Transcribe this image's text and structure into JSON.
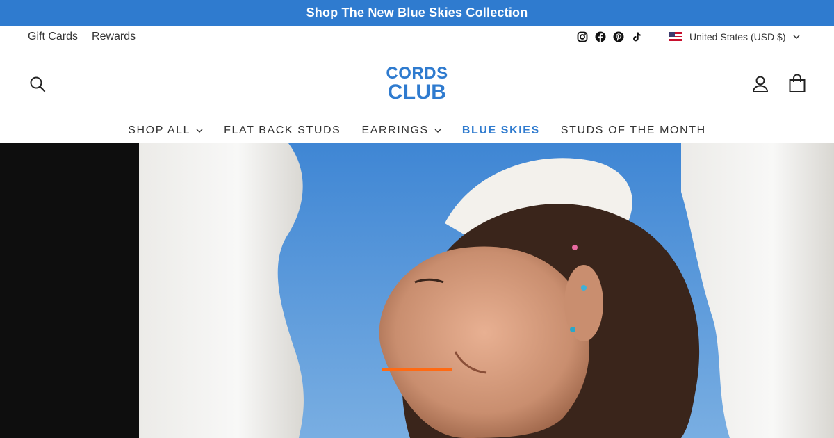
{
  "announcement": {
    "text": "Shop The New Blue Skies Collection"
  },
  "utility": {
    "links": [
      {
        "label": "Gift Cards"
      },
      {
        "label": "Rewards"
      }
    ],
    "social_icons": [
      "instagram-icon",
      "facebook-icon",
      "pinterest-icon",
      "tiktok-icon"
    ],
    "currency": {
      "label": "United States (USD $)",
      "flag": "us-flag-icon"
    }
  },
  "header": {
    "logo": {
      "line1": "CORDS",
      "line2": "CLUB"
    },
    "icons": [
      "search-icon",
      "account-icon",
      "cart-icon"
    ]
  },
  "nav": {
    "items": [
      {
        "label": "SHOP ALL",
        "has_dropdown": true
      },
      {
        "label": "FLAT BACK STUDS",
        "has_dropdown": false
      },
      {
        "label": "EARRINGS",
        "has_dropdown": true
      },
      {
        "label": "BLUE SKIES",
        "has_dropdown": false,
        "active": true
      },
      {
        "label": "STUDS OF THE MONTH",
        "has_dropdown": false
      }
    ]
  },
  "colors": {
    "brand_blue": "#2f7bcf",
    "announcement_bg": "#2f7bcf",
    "slider_indicator": "#ff6a13",
    "hero_left_panel": "#0e0e0e"
  }
}
